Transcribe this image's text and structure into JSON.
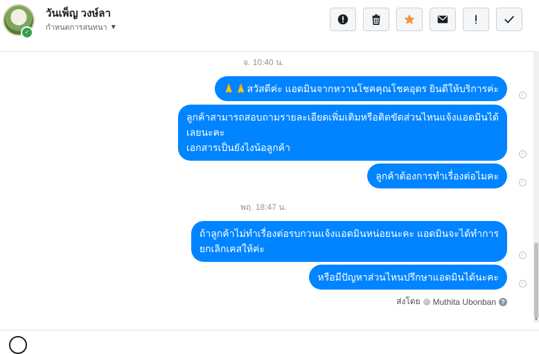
{
  "header": {
    "contact_name": "วันเพ็ญ วงษ์ลา",
    "assign_label": "กำหนดการสนทนา"
  },
  "toolbar": {
    "buttons": [
      {
        "name": "mark-spam",
        "icon": "exclamation-circle-icon"
      },
      {
        "name": "delete",
        "icon": "trash-icon"
      },
      {
        "name": "star",
        "icon": "star-icon",
        "color": "#f7923b"
      },
      {
        "name": "mark-unread",
        "icon": "envelope-icon"
      },
      {
        "name": "follow-up",
        "icon": "exclamation-icon"
      },
      {
        "name": "mark-done",
        "icon": "checkmark-icon"
      }
    ]
  },
  "conversation": {
    "timestamps": [
      "จ. 10:40 น.",
      "พฤ. 18:47 น."
    ],
    "messages": [
      {
        "emoji": "🙏🙏",
        "lines": [
          "สวัสดีค่ะ แอดมินจากหวานโชคคุณโชคอุดร ยินดีให้บริการค่ะ"
        ]
      },
      {
        "lines": [
          "ลูกค้าสามารถสอบถามรายละเอียดเพิ่มเติมหรือติดขัดส่วนไหนแจ้งแอดมินได้",
          "เลยนะคะ",
          "เอกสารเป็นยังไงน้อลูกค้า"
        ]
      },
      {
        "lines": [
          "ลูกค้าต้องการทำเรื่องต่อไมคะ"
        ]
      },
      {
        "lines": [
          "ถ้าลูกค้าไม่ทำเรื่องต่อรบกวนแจ้งแอดมินหน่อยนะคะ แอดมินจะได้ทำการ",
          "ยกเลิกเคสให้ค่ะ"
        ]
      },
      {
        "lines": [
          "หรือมีปัญหาส่วนไหนปรึกษาแอดมินได้นะคะ"
        ]
      }
    ],
    "sent_by_label": "ส่งโดย",
    "sent_by_name": "Muthita Ubonban"
  },
  "colors": {
    "bubble": "#0084ff",
    "bubble_text": "#ffffff",
    "timestamp": "#90949c"
  }
}
